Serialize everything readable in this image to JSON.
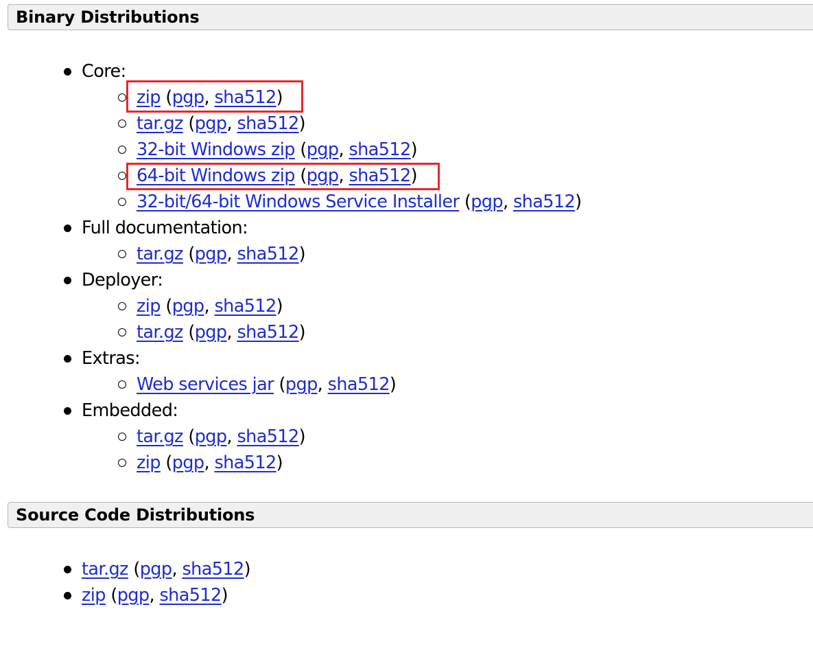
{
  "binary": {
    "title": "Binary Distributions",
    "groups": [
      {
        "label": "Core:",
        "items": [
          {
            "name": "zip",
            "pgp": "pgp",
            "sha": "sha512"
          },
          {
            "name": "tar.gz",
            "pgp": "pgp",
            "sha": "sha512"
          },
          {
            "name": "32-bit Windows zip",
            "pgp": "pgp",
            "sha": "sha512"
          },
          {
            "name": "64-bit Windows zip",
            "pgp": "pgp",
            "sha": "sha512"
          },
          {
            "name": "32-bit/64-bit Windows Service Installer",
            "pgp": "pgp",
            "sha": "sha512"
          }
        ]
      },
      {
        "label": "Full documentation:",
        "items": [
          {
            "name": "tar.gz",
            "pgp": "pgp",
            "sha": "sha512"
          }
        ]
      },
      {
        "label": "Deployer:",
        "items": [
          {
            "name": "zip",
            "pgp": "pgp",
            "sha": "sha512"
          },
          {
            "name": "tar.gz",
            "pgp": "pgp",
            "sha": "sha512"
          }
        ]
      },
      {
        "label": "Extras:",
        "items": [
          {
            "name": "Web services jar",
            "pgp": "pgp",
            "sha": "sha512"
          }
        ]
      },
      {
        "label": "Embedded:",
        "items": [
          {
            "name": "tar.gz",
            "pgp": "pgp",
            "sha": "sha512"
          },
          {
            "name": "zip",
            "pgp": "pgp",
            "sha": "sha512"
          }
        ]
      }
    ]
  },
  "source": {
    "title": "Source Code Distributions",
    "items": [
      {
        "name": "tar.gz",
        "pgp": "pgp",
        "sha": "sha512"
      },
      {
        "name": "zip",
        "pgp": "pgp",
        "sha": "sha512"
      }
    ]
  },
  "punct": {
    "open": " (",
    "comma": ", ",
    "close": ")"
  },
  "colors": {
    "link": "#1d2bd4",
    "highlight": "#e8262b",
    "header_bg": "#f0f0f0"
  }
}
